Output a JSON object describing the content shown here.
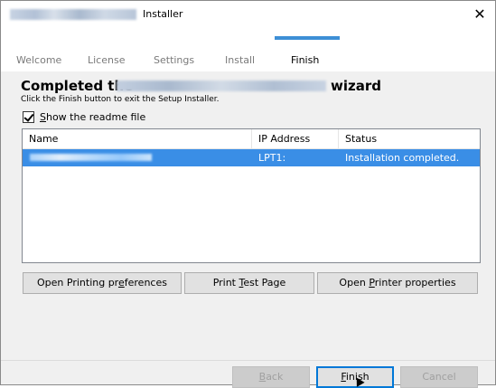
{
  "window": {
    "title": "Installer",
    "close_glyph": "✕"
  },
  "steps": [
    "Welcome",
    "License",
    "Settings",
    "Install",
    "Finish"
  ],
  "active_step": "Finish",
  "header": {
    "heading_prefix": "Completed the",
    "heading_suffix": "wizard",
    "subtext": "Click the Finish button to exit the Setup Installer."
  },
  "readme": {
    "checked": true,
    "label_u": "S",
    "label_rest": "how the readme file"
  },
  "list": {
    "columns": [
      "Name",
      "IP Address",
      "Status"
    ],
    "rows": [
      {
        "ip": "LPT1:",
        "status": "Installation completed."
      }
    ]
  },
  "actions": {
    "open_prefs": {
      "a": "Open Printing pr",
      "u": "e",
      "b": "ferences"
    },
    "print_test": {
      "a": "Print ",
      "u": "T",
      "b": "est Page"
    },
    "open_props": {
      "a": "Open ",
      "u": "P",
      "b": "rinter properties"
    }
  },
  "footer": {
    "back": {
      "u": "B",
      "b": "ack"
    },
    "finish": {
      "u": "F",
      "b": "inish"
    },
    "cancel": "Cancel"
  },
  "colors": {
    "accent": "#3d8fd6",
    "selection": "#3a8ee6"
  }
}
